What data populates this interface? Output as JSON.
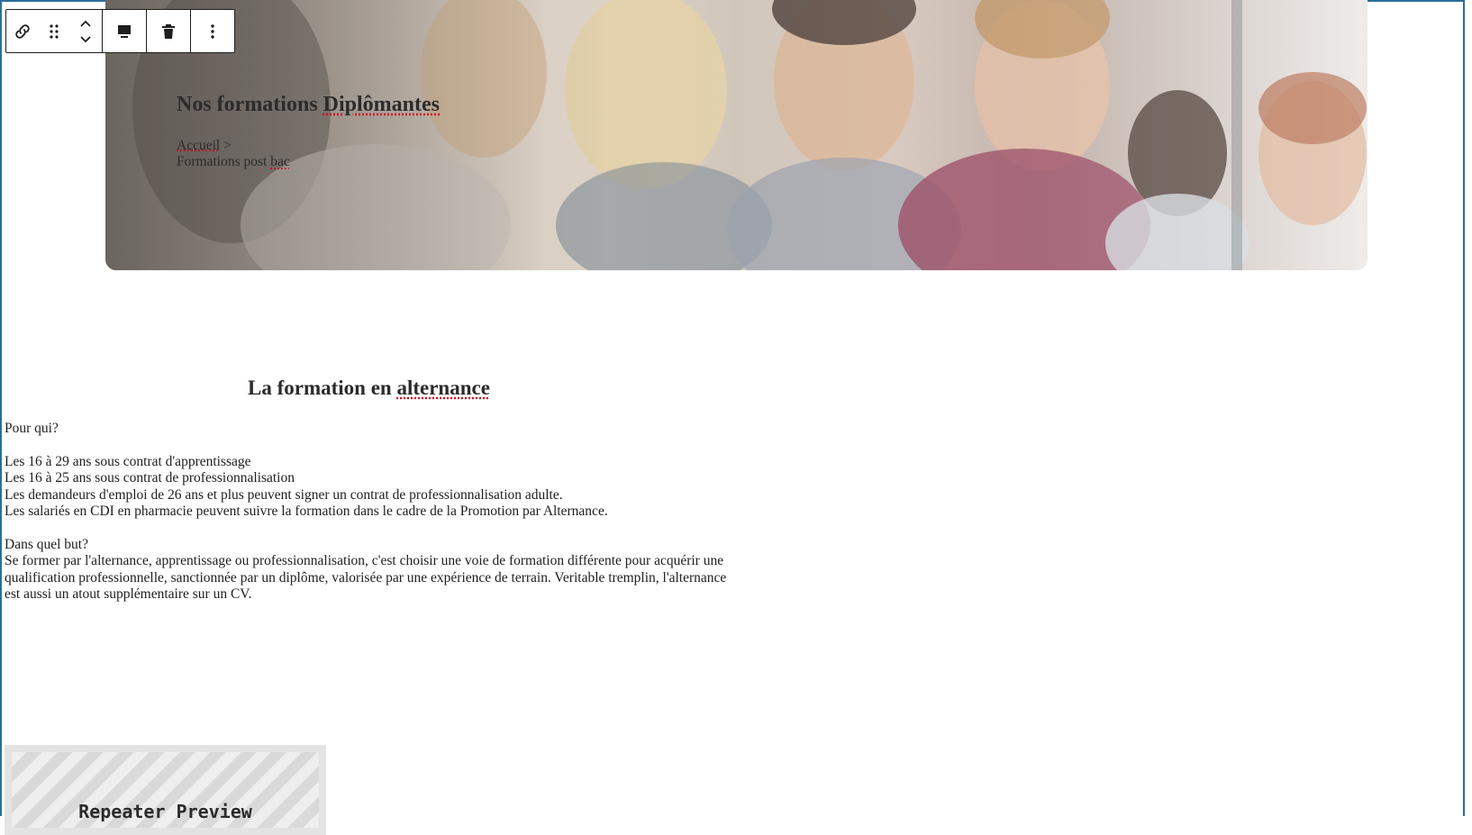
{
  "toolbar": {
    "buttons": [
      "link-icon",
      "drag-handle-icon",
      "move-up-icon",
      "move-down-icon",
      "block-align-icon",
      "trash-icon",
      "more-options-icon"
    ]
  },
  "hero": {
    "title_prefix": "Nos formations ",
    "title_underlined": "Diplômantes",
    "breadcrumb_home": "Accueil",
    "breadcrumb_sep": " >",
    "breadcrumb_current_prefix": "Formations post ",
    "breadcrumb_current_underlined": "bac"
  },
  "section": {
    "title_prefix": "La formation en ",
    "title_underlined": "alternance"
  },
  "content": {
    "who_heading": "Pour qui?",
    "who_items": [
      "Les 16 à 29 ans sous contrat d'apprentissage",
      "Les 16 à 25 ans sous contrat de professionnalisation",
      "Les demandeurs d'emploi de 26 ans et plus peuvent signer un contrat de professionnalisation adulte.",
      "Les salariés en CDI en pharmacie peuvent suivre la formation dans le cadre de la Promotion par Alternance."
    ],
    "why_heading": "Dans quel but?",
    "why_text": "Se former par l'alternance, apprentissage ou professionnalisation, c'est choisir une voie de formation différente pour acquérir une qualification professionnelle, sanctionnée par un diplôme, valorisée par une expérience de terrain. Veritable tremplin, l'alternance est aussi un atout supplémentaire sur un CV."
  },
  "repeater": {
    "label": "Repeater Preview"
  }
}
